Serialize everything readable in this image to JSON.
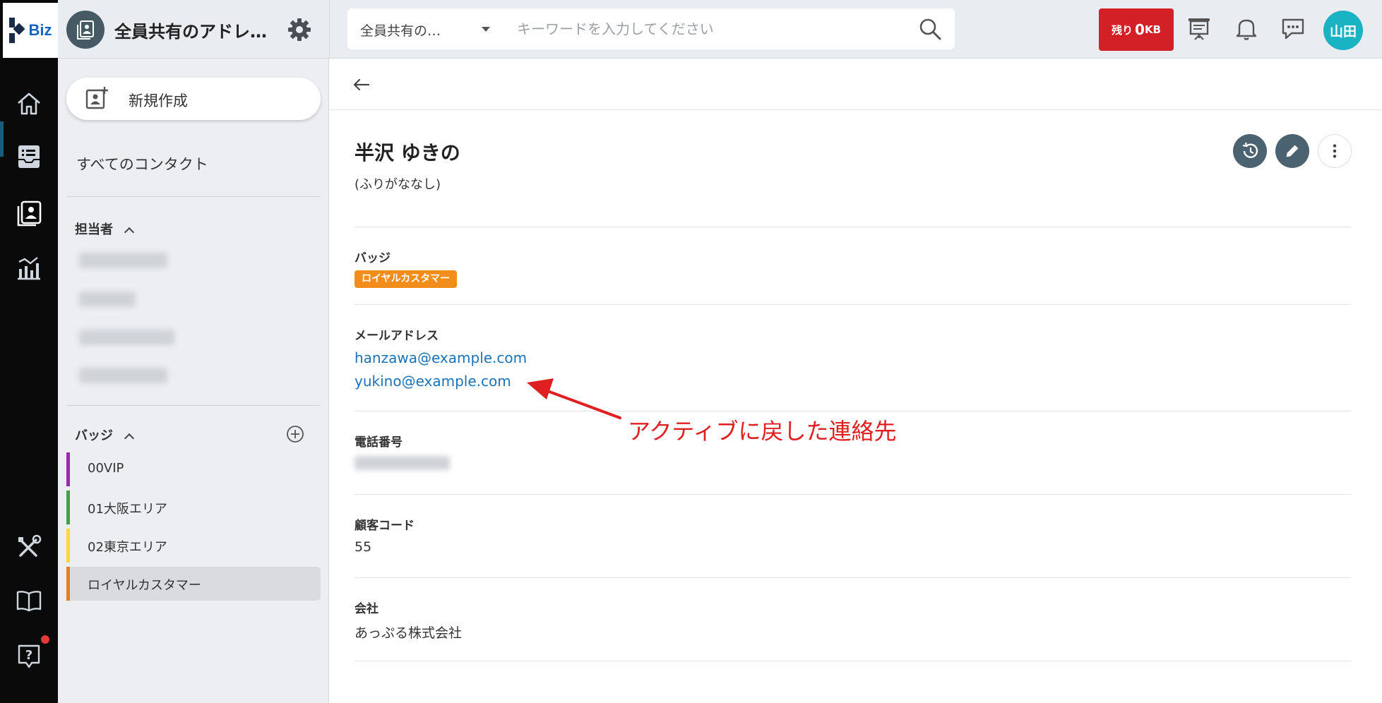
{
  "logo": {
    "text": "Biz"
  },
  "app": {
    "title": "全員共有のアドレス帳",
    "title_display": "全員共有のアドレ…"
  },
  "search": {
    "scope": "全員共有の…",
    "placeholder": "キーワードを入力してください"
  },
  "storage": {
    "prefix": "残り",
    "value": "0",
    "unit": "KB"
  },
  "user": {
    "avatar_text": "山田"
  },
  "sidebar": {
    "new_button": "新規作成",
    "all_contacts": "すべてのコンタクト",
    "owner_section": "担当者",
    "badge_section": "バッジ",
    "badges": [
      {
        "label": "00VIP",
        "color": "#9c27b0"
      },
      {
        "label": "01大阪エリア",
        "color": "#43a047"
      },
      {
        "label": "02東京エリア",
        "color": "#fdd835"
      },
      {
        "label": "ロイヤルカスタマー",
        "color": "#e67e22"
      }
    ]
  },
  "contact": {
    "name": "半沢 ゆきの",
    "furigana": "(ふりがななし)",
    "badge_label": "バッジ",
    "badge_value": "ロイヤルカスタマー",
    "email_label": "メールアドレス",
    "emails": [
      "hanzawa@example.com",
      "yukino@example.com"
    ],
    "phone_label": "電話番号",
    "customer_code_label": "顧客コード",
    "customer_code": "55",
    "company_label": "会社",
    "company": "あっぷる株式会社"
  },
  "annotation": {
    "text": "アクティブに戻した連絡先",
    "color": "#e02020"
  },
  "colors": {
    "storage_red": "#d32027",
    "action_button": "#4b6270",
    "badge_orange": "#f28c1b",
    "link_blue": "#1a73b8",
    "avatar_teal": "#1ab3c4"
  }
}
